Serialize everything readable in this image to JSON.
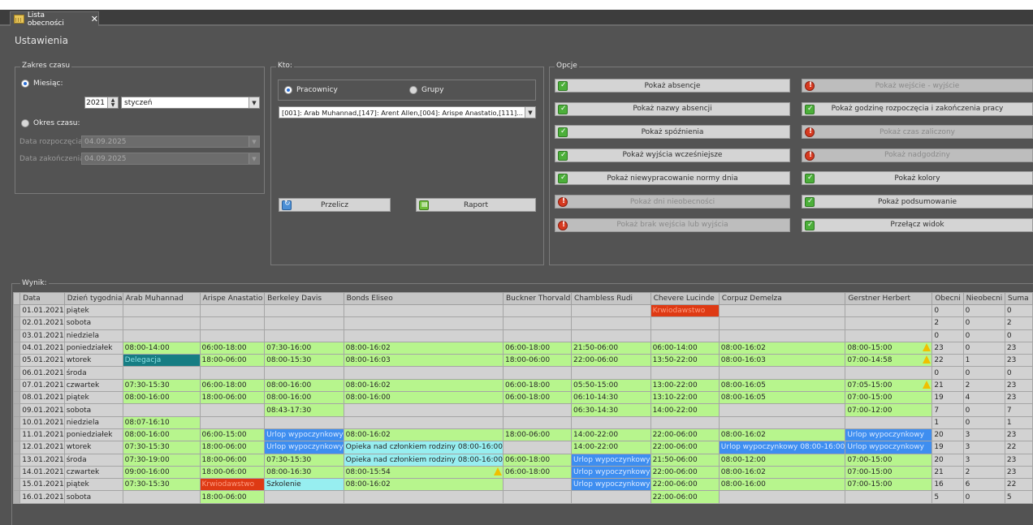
{
  "tab": {
    "title": "Lista obecności",
    "close": "✕"
  },
  "settings_title": "Ustawienia",
  "zakres": {
    "label": "Zakres czasu",
    "miesiac_label": "Miesiąc:",
    "year": "2021",
    "month": "styczeń",
    "okres_label": "Okres czasu:",
    "start_label": "Data rozpoczęcia:",
    "start_value": "04.09.2025",
    "end_label": "Data zakończenia:",
    "end_value": "04.09.2025"
  },
  "kto": {
    "label": "Kto:",
    "pracownicy": "Pracownicy",
    "grupy": "Grupy",
    "selected": "[001]: Arab Muhannad,[147]: Arent Allen,[004]: Arispe Anastatio,[111]...",
    "przelicz": "Przelicz",
    "raport": "Raport"
  },
  "opcje": {
    "label": "Opcje",
    "left": [
      {
        "label": "Pokaż absencje",
        "on": true
      },
      {
        "label": "Pokaż nazwy absencji",
        "on": true
      },
      {
        "label": "Pokaż spóźnienia",
        "on": true
      },
      {
        "label": "Pokaż wyjścia wcześniejsze",
        "on": true
      },
      {
        "label": "Pokaż niewypracowanie normy dnia",
        "on": true
      },
      {
        "label": "Pokaż dni nieobecności",
        "on": false
      },
      {
        "label": "Pokaż brak wejścia lub wyjścia",
        "on": false
      }
    ],
    "right": [
      {
        "label": "Pokaż wejście - wyjście",
        "on": false
      },
      {
        "label": "Pokaż godzinę rozpoczęcia i zakończenia pracy",
        "on": true
      },
      {
        "label": "Pokaż czas zaliczony",
        "on": false
      },
      {
        "label": "Pokaż nadgodziny",
        "on": false
      },
      {
        "label": "Pokaż kolory",
        "on": true
      },
      {
        "label": "Pokaż podsumowanie",
        "on": true
      },
      {
        "label": "Przełącz widok",
        "on": true
      }
    ]
  },
  "wynik": {
    "label": "Wynik:",
    "columns": [
      "Data",
      "Dzień tygodnia",
      "Arab Muhannad",
      "Arispe Anastatio",
      "Berkeley Davis",
      "Bonds Eliseo",
      "Buckner Thorvald",
      "Chambless Rudi",
      "Chevere Lucinde",
      "Corpuz Demelza",
      "Gerstner Herbert",
      "Obecni",
      "Nieobecni",
      "Suma"
    ],
    "rows": [
      [
        [
          "01.01.2021"
        ],
        [
          "piątek"
        ],
        [
          "",
          ""
        ],
        [
          "",
          ""
        ],
        [
          "",
          ""
        ],
        [
          "",
          ""
        ],
        [
          "",
          ""
        ],
        [
          "",
          ""
        ],
        [
          "Krwiodawstwo",
          "r"
        ],
        [
          "",
          ""
        ],
        [
          "",
          ""
        ],
        [
          "0"
        ],
        [
          "0"
        ],
        [
          "0"
        ]
      ],
      [
        [
          "02.01.2021"
        ],
        [
          "sobota"
        ],
        [
          "",
          ""
        ],
        [
          "",
          ""
        ],
        [
          "",
          ""
        ],
        [
          "",
          ""
        ],
        [
          "",
          ""
        ],
        [
          "",
          ""
        ],
        [
          "",
          ""
        ],
        [
          "",
          ""
        ],
        [
          "",
          ""
        ],
        [
          "2"
        ],
        [
          "0"
        ],
        [
          "2"
        ]
      ],
      [
        [
          "03.01.2021"
        ],
        [
          "niedziela"
        ],
        [
          "",
          ""
        ],
        [
          "",
          ""
        ],
        [
          "",
          ""
        ],
        [
          "",
          ""
        ],
        [
          "",
          ""
        ],
        [
          "",
          ""
        ],
        [
          "",
          ""
        ],
        [
          "",
          ""
        ],
        [
          "",
          ""
        ],
        [
          "0"
        ],
        [
          "0"
        ],
        [
          "0"
        ]
      ],
      [
        [
          "04.01.2021"
        ],
        [
          "poniedziałek"
        ],
        [
          "08:00-14:00",
          "g"
        ],
        [
          "06:00-18:00",
          "g"
        ],
        [
          "07:30-16:00",
          "g"
        ],
        [
          "08:00-16:02",
          "g"
        ],
        [
          "06:00-18:00",
          "g"
        ],
        [
          "21:50-06:00",
          "g"
        ],
        [
          "06:00-14:00",
          "g"
        ],
        [
          "08:00-16:02",
          "g"
        ],
        [
          "08:00-15:00",
          "g",
          "w"
        ],
        [
          "23"
        ],
        [
          "0"
        ],
        [
          "23"
        ]
      ],
      [
        [
          "05.01.2021"
        ],
        [
          "wtorek"
        ],
        [
          "Delegacja",
          "t"
        ],
        [
          "18:00-06:00",
          "g"
        ],
        [
          "08:00-15:30",
          "g"
        ],
        [
          "08:00-16:03",
          "g"
        ],
        [
          "18:00-06:00",
          "g"
        ],
        [
          "22:00-06:00",
          "g"
        ],
        [
          "13:50-22:00",
          "g"
        ],
        [
          "08:00-16:03",
          "g"
        ],
        [
          "07:00-14:58",
          "g",
          "w"
        ],
        [
          "22"
        ],
        [
          "1"
        ],
        [
          "23"
        ]
      ],
      [
        [
          "06.01.2021"
        ],
        [
          "środa"
        ],
        [
          "",
          ""
        ],
        [
          "",
          ""
        ],
        [
          "",
          ""
        ],
        [
          "",
          ""
        ],
        [
          "",
          ""
        ],
        [
          "",
          ""
        ],
        [
          "",
          ""
        ],
        [
          "",
          ""
        ],
        [
          "",
          ""
        ],
        [
          "0"
        ],
        [
          "0"
        ],
        [
          "0"
        ]
      ],
      [
        [
          "07.01.2021"
        ],
        [
          "czwartek"
        ],
        [
          "07:30-15:30",
          "g"
        ],
        [
          "06:00-18:00",
          "g"
        ],
        [
          "08:00-16:00",
          "g"
        ],
        [
          "08:00-16:02",
          "g"
        ],
        [
          "06:00-18:00",
          "g"
        ],
        [
          "05:50-15:00",
          "g"
        ],
        [
          "13:00-22:00",
          "g"
        ],
        [
          "08:00-16:05",
          "g"
        ],
        [
          "07:05-15:00",
          "g",
          "w"
        ],
        [
          "21"
        ],
        [
          "2"
        ],
        [
          "23"
        ]
      ],
      [
        [
          "08.01.2021"
        ],
        [
          "piątek"
        ],
        [
          "08:00-16:00",
          "g"
        ],
        [
          "18:00-06:00",
          "g"
        ],
        [
          "08:00-16:00",
          "g"
        ],
        [
          "08:00-16:00",
          "g"
        ],
        [
          "06:00-18:00",
          "g"
        ],
        [
          "06:10-14:30",
          "g"
        ],
        [
          "13:10-22:00",
          "g"
        ],
        [
          "08:00-16:05",
          "g"
        ],
        [
          "07:00-15:00",
          "g"
        ],
        [
          "19"
        ],
        [
          "4"
        ],
        [
          "23"
        ]
      ],
      [
        [
          "09.01.2021"
        ],
        [
          "sobota"
        ],
        [
          "",
          ""
        ],
        [
          "",
          ""
        ],
        [
          "08:43-17:30",
          "g"
        ],
        [
          "",
          ""
        ],
        [
          "",
          ""
        ],
        [
          "06:30-14:30",
          "g"
        ],
        [
          "14:00-22:00",
          "g"
        ],
        [
          "",
          ""
        ],
        [
          "07:00-12:00",
          "g"
        ],
        [
          "7"
        ],
        [
          "0"
        ],
        [
          "7"
        ]
      ],
      [
        [
          "10.01.2021"
        ],
        [
          "niedziela"
        ],
        [
          "08:07-16:10",
          "g"
        ],
        [
          "",
          ""
        ],
        [
          "",
          ""
        ],
        [
          "",
          ""
        ],
        [
          "",
          ""
        ],
        [
          "",
          ""
        ],
        [
          "",
          ""
        ],
        [
          "",
          ""
        ],
        [
          "",
          ""
        ],
        [
          "1"
        ],
        [
          "0"
        ],
        [
          "1"
        ]
      ],
      [
        [
          "11.01.2021"
        ],
        [
          "poniedziałek"
        ],
        [
          "08:00-16:00",
          "g"
        ],
        [
          "06:00-15:00",
          "g"
        ],
        [
          "Urlop wypoczynkowy",
          "b"
        ],
        [
          "08:00-16:02",
          "g"
        ],
        [
          "18:00-06:00",
          "g"
        ],
        [
          "14:00-22:00",
          "g"
        ],
        [
          "22:00-06:00",
          "g"
        ],
        [
          "08:00-16:02",
          "g"
        ],
        [
          "Urlop wypoczynkowy",
          "b"
        ],
        [
          "20"
        ],
        [
          "3"
        ],
        [
          "23"
        ]
      ],
      [
        [
          "12.01.2021"
        ],
        [
          "wtorek"
        ],
        [
          "07:30-15:30",
          "g"
        ],
        [
          "18:00-06:00",
          "g"
        ],
        [
          "Urlop wypoczynkowy",
          "b"
        ],
        [
          "Opieka nad członkiem rodziny 08:00-16:00",
          "c"
        ],
        [
          "",
          ""
        ],
        [
          "14:00-22:00",
          "g"
        ],
        [
          "22:00-06:00",
          "g"
        ],
        [
          "Urlop wypoczynkowy 08:00-16:00",
          "b"
        ],
        [
          "Urlop wypoczynkowy",
          "b"
        ],
        [
          "19"
        ],
        [
          "3"
        ],
        [
          "22"
        ]
      ],
      [
        [
          "13.01.2021"
        ],
        [
          "środa"
        ],
        [
          "07:30-19:00",
          "g"
        ],
        [
          "18:00-06:00",
          "g"
        ],
        [
          "07:30-15:30",
          "g"
        ],
        [
          "Opieka nad członkiem rodziny 08:00-16:00",
          "c"
        ],
        [
          "06:00-18:00",
          "g"
        ],
        [
          "Urlop wypoczynkowy",
          "b"
        ],
        [
          "21:50-06:00",
          "g"
        ],
        [
          "08:00-12:00",
          "g"
        ],
        [
          "07:00-15:00",
          "g"
        ],
        [
          "20"
        ],
        [
          "3"
        ],
        [
          "23"
        ]
      ],
      [
        [
          "14.01.2021"
        ],
        [
          "czwartek"
        ],
        [
          "09:00-16:00",
          "g"
        ],
        [
          "18:00-06:00",
          "g"
        ],
        [
          "08:00-16:30",
          "g"
        ],
        [
          "08:00-15:54",
          "g",
          "w"
        ],
        [
          "06:00-18:00",
          "g"
        ],
        [
          "Urlop wypoczynkowy",
          "b"
        ],
        [
          "22:00-06:00",
          "g"
        ],
        [
          "08:00-16:02",
          "g"
        ],
        [
          "07:00-15:00",
          "g"
        ],
        [
          "21"
        ],
        [
          "2"
        ],
        [
          "23"
        ]
      ],
      [
        [
          "15.01.2021"
        ],
        [
          "piątek"
        ],
        [
          "07:30-15:30",
          "g"
        ],
        [
          "Krwiodawstwo",
          "r"
        ],
        [
          "Szkolenie",
          "c"
        ],
        [
          "08:00-16:02",
          "g"
        ],
        [
          "",
          ""
        ],
        [
          "Urlop wypoczynkowy",
          "b"
        ],
        [
          "22:00-06:00",
          "g"
        ],
        [
          "08:00-16:00",
          "g"
        ],
        [
          "07:00-15:00",
          "g"
        ],
        [
          "16"
        ],
        [
          "6"
        ],
        [
          "22"
        ]
      ],
      [
        [
          "16.01.2021"
        ],
        [
          "sobota"
        ],
        [
          "",
          ""
        ],
        [
          "18:00-06:00",
          "g"
        ],
        [
          "",
          ""
        ],
        [
          "",
          ""
        ],
        [
          "",
          ""
        ],
        [
          "",
          ""
        ],
        [
          "22:00-06:00",
          "g"
        ],
        [
          "",
          ""
        ],
        [
          "",
          ""
        ],
        [
          "5"
        ],
        [
          "0"
        ],
        [
          "5"
        ]
      ]
    ]
  }
}
